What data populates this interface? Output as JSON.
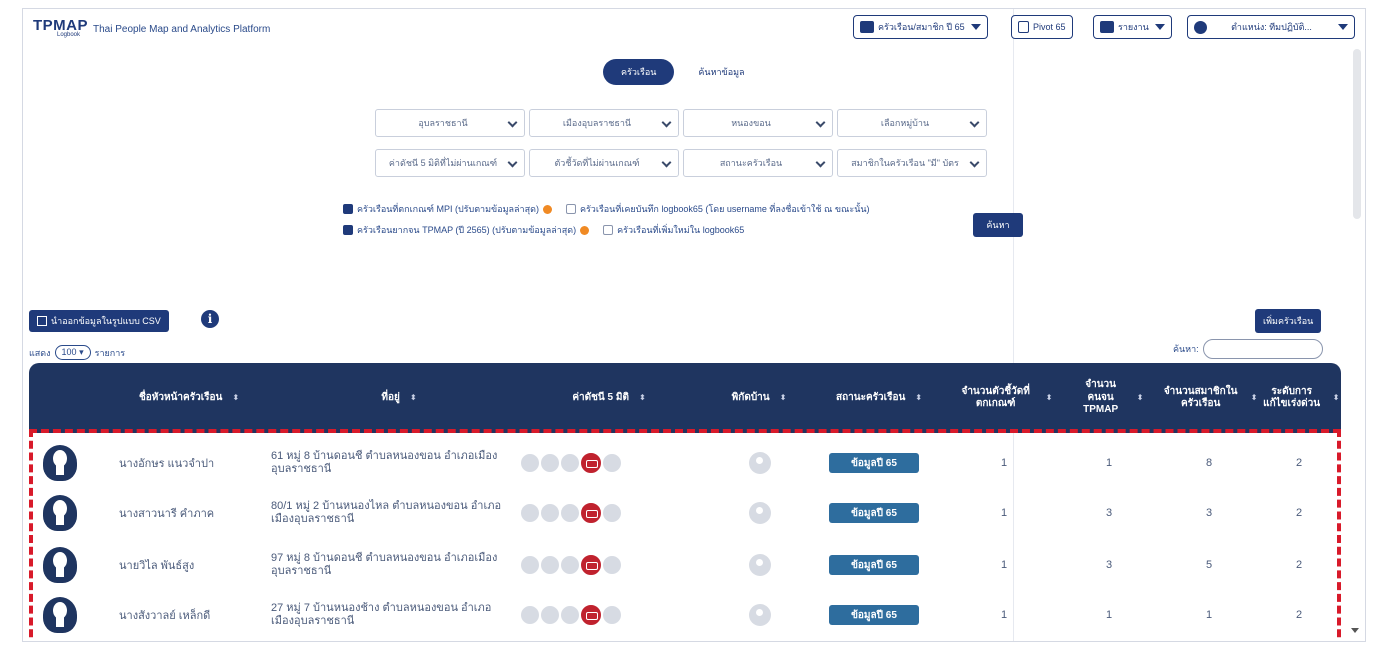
{
  "header": {
    "logo": "TPMAP",
    "logo_sub": "Logbook",
    "app_title": "Thai People Map and Analytics Platform",
    "household_menu": "ครัวเรือน/สมาชิก ปี 65",
    "pivot_label": "Pivot 65",
    "report_label": "รายงาน",
    "user_label": "ตำแหน่ง: ทีมปฏิบัติ..."
  },
  "tabs": [
    {
      "label": "ครัวเรือน",
      "active": true
    },
    {
      "label": "ค้นหาข้อมูล",
      "active": false
    }
  ],
  "filters": {
    "row1": [
      "อุบลราชธานี",
      "เมืองอุบลราชธานี",
      "หนองขอน",
      "เลือกหมู่บ้าน"
    ],
    "row2": [
      "ค่าดัชนี 5 มิติที่ไม่ผ่านเกณฑ์",
      "ตัวชี้วัดที่ไม่ผ่านเกณฑ์",
      "สถานะครัวเรือน",
      "สมาชิกในครัวเรือน \"มี\" บัตร"
    ]
  },
  "checkboxes": {
    "mpi": "ครัวเรือนที่ตกเกณฑ์ MPI (ปรับตามข้อมูลล่าสุด)",
    "tpmap": "ครัวเรือนยากจน TPMAP (ปี 2565) (ปรับตามข้อมูลล่าสุด)",
    "logbook_saved": "ครัวเรือนที่เคยบันทึก logbook65 (โดย username ที่ลงชื่อเข้าใช้ ณ ขณะนั้น)",
    "logbook_new": "ครัวเรือนที่เพิ่มใหม่ใน logbook65"
  },
  "search_button": "ค้นหา",
  "csv_button": "นำออกข้อมูลในรูปแบบ CSV",
  "show": {
    "prefix": "แสดง",
    "value": "100",
    "suffix": "รายการ"
  },
  "add_button": "เพิ่มครัวเรือน",
  "find_label": "ค้นหา:",
  "columns": [
    "ชื่อหัวหน้าครัวเรือน",
    "ที่อยู่",
    "ค่าดัชนี 5 มิติ",
    "พิกัดบ้าน",
    "สถานะครัวเรือน",
    "จำนวนตัวชี้วัดที่ตกเกณฑ์",
    "จำนวนคนจน TPMAP",
    "จำนวนสมาชิกในครัวเรือน",
    "ระดับการแก้ไขเร่งด่วน"
  ],
  "rows": [
    {
      "name": "นางอักษร แนวจำปา",
      "address": "61 หมู่ 8 บ้านดอนชี ตำบลหนองขอน อำเภอเมืองอุบลราชธานี",
      "status": "ข้อมูลปี 65",
      "indicators": "1",
      "poor": "1",
      "members": "8",
      "urgency": "2"
    },
    {
      "name": "นางสาวนารี คำภาค",
      "address": "80/1 หมู่ 2 บ้านหนองไหล ตำบลหนองขอน อำเภอเมืองอุบลราชธานี",
      "status": "ข้อมูลปี 65",
      "indicators": "1",
      "poor": "3",
      "members": "3",
      "urgency": "2"
    },
    {
      "name": "นายวิไล พันธ์สูง",
      "address": "97 หมู่ 8 บ้านดอนชี ตำบลหนองขอน อำเภอเมืองอุบลราชธานี",
      "status": "ข้อมูลปี 65",
      "indicators": "1",
      "poor": "3",
      "members": "5",
      "urgency": "2"
    },
    {
      "name": "นางสังวาลย์ เหล็กดี",
      "address": "27 หมู่ 7 บ้านหนองช้าง ตำบลหนองขอน อำเภอเมืองอุบลราชธานี",
      "status": "ข้อมูลปี 65",
      "indicators": "1",
      "poor": "1",
      "members": "1",
      "urgency": "2"
    }
  ]
}
